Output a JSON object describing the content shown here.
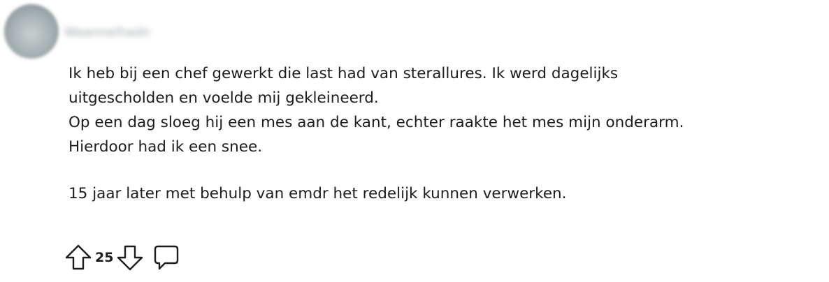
{
  "comment": {
    "author": "Waannelhadn",
    "paragraphs": [
      [
        "Ik heb bij een chef gewerkt die last had van sterallures. Ik werd dagelijks",
        "uitgescholden en voelde mij gekleineerd."
      ],
      [
        "Op een dag sloeg hij een mes aan de kant, echter raakte het mes mijn onderarm.",
        "Hierdoor had ik een snee."
      ],
      [
        "15 jaar later met behulp van emdr het redelijk kunnen verwerken."
      ]
    ],
    "votes": "25"
  },
  "icons": {
    "upvote": "arrow-up-outline-icon",
    "downvote": "arrow-down-outline-icon",
    "reply": "speech-bubble-icon"
  },
  "colors": {
    "text": "#1c1c1c",
    "icon_stroke": "#1c1c1c",
    "background": "#ffffff"
  }
}
